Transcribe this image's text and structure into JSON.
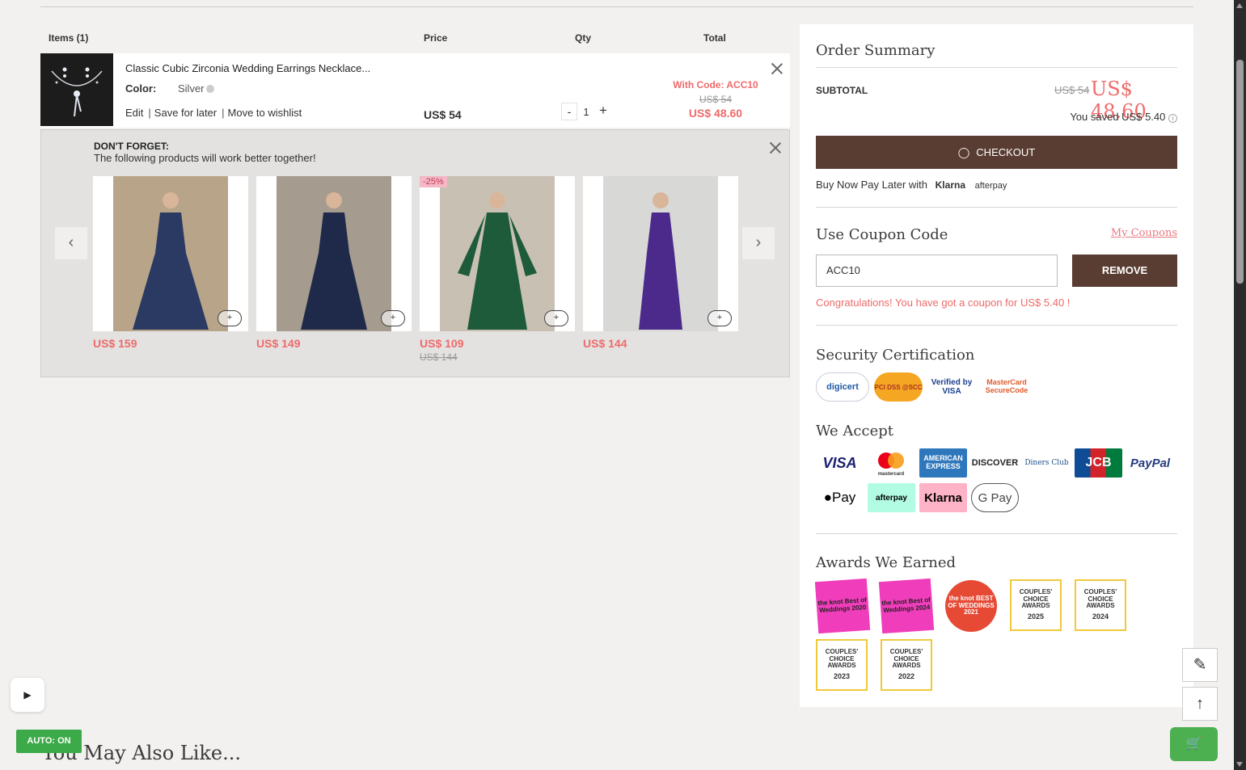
{
  "cart": {
    "headers": {
      "items": "Items (1)",
      "price": "Price",
      "qty": "Qty",
      "total": "Total"
    },
    "item": {
      "title": "Classic Cubic Zirconia Wedding Earrings Necklace...",
      "color_label": "Color:",
      "color_value": "Silver",
      "actions": {
        "edit": "Edit",
        "save": "Save for later",
        "wishlist": "Move to wishlist"
      },
      "price": "US$ 54",
      "qty": "1",
      "qty_minus": "-",
      "qty_plus": "+",
      "code_text": "With Code: ACC10",
      "total_old": "US$ 54",
      "total_new": "US$ 48.60"
    }
  },
  "dont_forget": {
    "title": "DON'T FORGET:",
    "subtitle": "The following products will work better together!",
    "products": [
      {
        "price": "US$ 159",
        "old_price": "",
        "badge": "",
        "color": "#2b3a63"
      },
      {
        "price": "US$ 149",
        "old_price": "",
        "badge": "",
        "color": "#1f2a4a"
      },
      {
        "price": "US$ 109",
        "old_price": "US$ 144",
        "badge": "-25%",
        "color": "#1e5b3a"
      },
      {
        "price": "US$ 144",
        "old_price": "",
        "badge": "",
        "color": "#4b2a8c"
      }
    ]
  },
  "summary": {
    "title": "Order Summary",
    "subtotal_label": "SUBTOTAL",
    "subtotal_old": "US$ 54",
    "subtotal_new": "US$ 48.60",
    "saved": "You saved US$ 5.40",
    "checkout": "CHECKOUT",
    "bnpl": "Buy Now Pay Later with",
    "klarna": "Klarna",
    "afterpay": "afterpay",
    "coupon_title": "Use Coupon Code",
    "my_coupons": "My Coupons",
    "coupon_value": "ACC10",
    "remove": "REMOVE",
    "congrats": "Congratulations! You have got a coupon for US$ 5.40 !",
    "security_title": "Security Certification",
    "security_logos": [
      "digicert",
      "PCI DSS @SCC",
      "Verified by VISA",
      "MasterCard SecureCode"
    ],
    "accept_title": "We Accept",
    "payments_row1": [
      "VISA",
      "mastercard",
      "AMERICAN EXPRESS",
      "DISCOVER",
      "Diners Club",
      "JCB",
      "PayPal"
    ],
    "payments_row2": [
      "Pay",
      "afterpay",
      "Klarna",
      "G Pay"
    ],
    "awards_title": "Awards We Earned",
    "awards": [
      {
        "text": "the knot Best of Weddings 2020"
      },
      {
        "text": "the knot Best of Weddings 2024"
      },
      {
        "text": "the knot BEST OF WEDDINGS 2021"
      },
      {
        "text": "COUPLES' CHOICE AWARDS",
        "year": "2025"
      },
      {
        "text": "COUPLES' CHOICE AWARDS",
        "year": "2024"
      },
      {
        "text": "COUPLES' CHOICE AWARDS",
        "year": "2023"
      },
      {
        "text": "COUPLES' CHOICE AWARDS",
        "year": "2022"
      }
    ]
  },
  "floating": {
    "auto": "AUTO: ON",
    "also_like": "You May Also Like..."
  }
}
